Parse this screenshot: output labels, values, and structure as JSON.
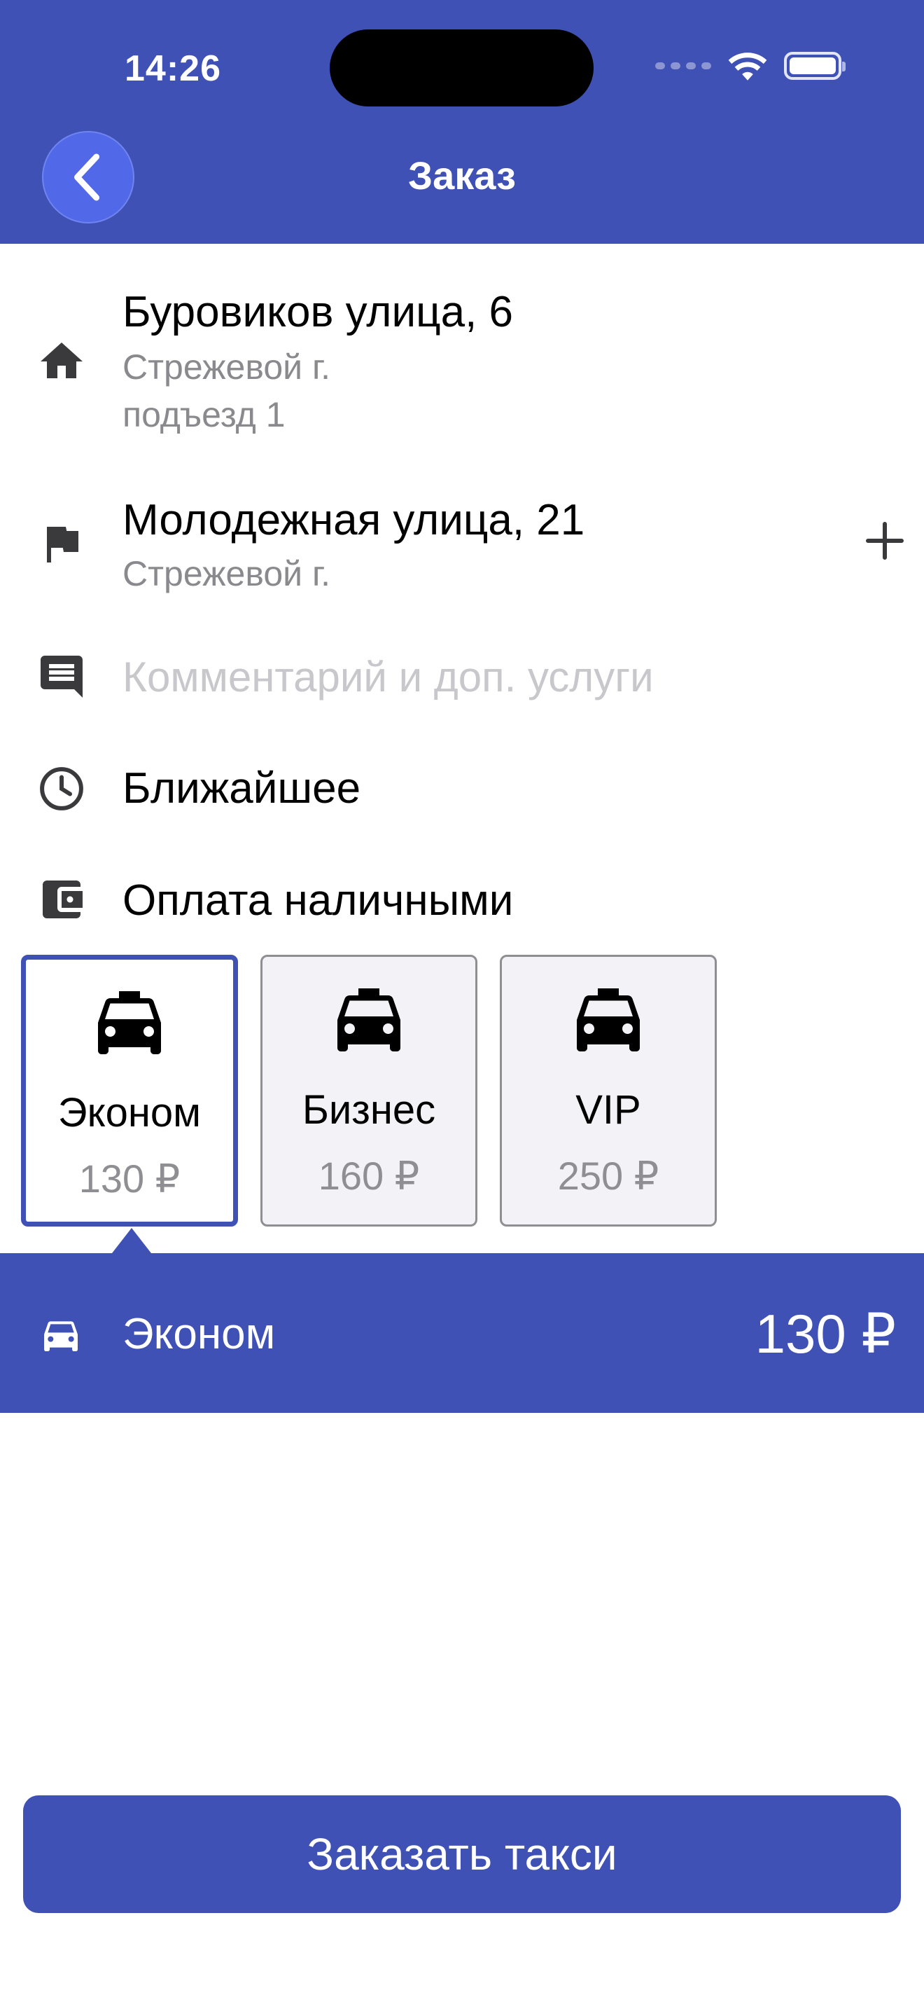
{
  "status_bar": {
    "time": "14:26"
  },
  "header": {
    "title": "Заказ"
  },
  "route": {
    "from": {
      "street": "Буровиков улица, 6",
      "city": "Стрежевой г.",
      "entrance": "подъезд 1"
    },
    "to": {
      "street": "Молодежная улица, 21",
      "city": "Стрежевой г."
    }
  },
  "comment": {
    "placeholder": "Комментарий и доп. услуги"
  },
  "time": {
    "label": "Ближайшее"
  },
  "payment": {
    "label": "Оплата наличными"
  },
  "tariffs": [
    {
      "name": "Эконом",
      "price": "130 ₽",
      "selected": true
    },
    {
      "name": "Бизнес",
      "price": "160 ₽",
      "selected": false
    },
    {
      "name": "VIP",
      "price": "250 ₽",
      "selected": false
    }
  ],
  "summary": {
    "tariff": "Эконом",
    "price": "130 ₽"
  },
  "order_button": {
    "label": "Заказать такси"
  },
  "colors": {
    "primary": "#3f51b5",
    "back_button": "#5169e8",
    "secondary_text": "#8a8a8e",
    "placeholder": "#c7c7cc"
  }
}
